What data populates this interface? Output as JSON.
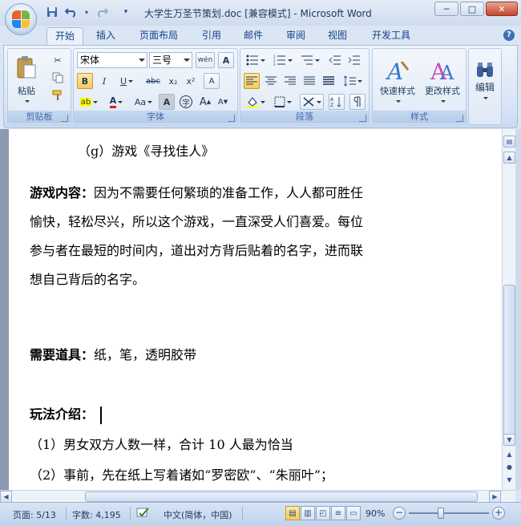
{
  "window": {
    "title": "大学生万圣节策划.doc [兼容模式] - Microsoft Word",
    "controls": {
      "minimize": "─",
      "maximize": "□",
      "close": "✕"
    }
  },
  "quick_access": [
    {
      "name": "save-icon",
      "glyph": "💾"
    },
    {
      "name": "undo-icon",
      "glyph": "↶"
    },
    {
      "name": "redo-icon",
      "glyph": "↷"
    },
    {
      "name": "customize-icon",
      "glyph": "▾"
    }
  ],
  "tabs": [
    "开始",
    "插入",
    "页面布局",
    "引用",
    "邮件",
    "审阅",
    "视图",
    "开发工具"
  ],
  "active_tab": "开始",
  "ribbon": {
    "clipboard": {
      "label": "剪贴板",
      "paste": "粘贴"
    },
    "font": {
      "label": "字体",
      "font_name": "宋体",
      "font_size": "三号",
      "phonetic_glyph": "wén",
      "border_glyph": "A",
      "bold": "B",
      "italic": "I",
      "underline": "U",
      "strike": "abc",
      "subscript": "x₂",
      "superscript": "x²",
      "clear_glyph": "A",
      "highlight_glyph": "ab",
      "font_color_glyph": "A",
      "change_case": "Aa",
      "shading_glyph": "A",
      "enclose_glyph": "字",
      "grow": "A",
      "shrink": "A"
    },
    "paragraph": {
      "label": "段落"
    },
    "styles": {
      "label": "样式",
      "quick_styles": "快速样式",
      "change_styles": "更改样式"
    },
    "editing": {
      "label": "编辑"
    }
  },
  "document": {
    "lines": [
      {
        "text": "（g）游戏《寻找佳人》"
      },
      {
        "bold": "游戏内容：",
        "text": "因为不需要任何繁琐的准备工作，人人都可胜任"
      },
      {
        "text": "愉快，轻松尽兴，所以这个游戏，一直深受人们喜爱。每位"
      },
      {
        "text": "参与者在最短的时间内，道出对方背后贴着的名字，进而联"
      },
      {
        "text": "想自己背后的名字。"
      },
      {
        "bold": "需要道具：",
        "text": "纸，笔，透明胶带"
      },
      {
        "bold": "玩法介绍：",
        "text": ""
      },
      {
        "text": "（1）男女双方人数一样，合计 10 人最为恰当"
      },
      {
        "text": "（2）事前，先在纸上写着诸如“罗密欧”、“朱丽叶”；"
      }
    ]
  },
  "statusbar": {
    "page": "页面: 5/13",
    "words": "字数: 4,195",
    "language": "中文(简体，中国)",
    "zoom": "90%",
    "zoom_out": "−",
    "zoom_in": "+"
  }
}
